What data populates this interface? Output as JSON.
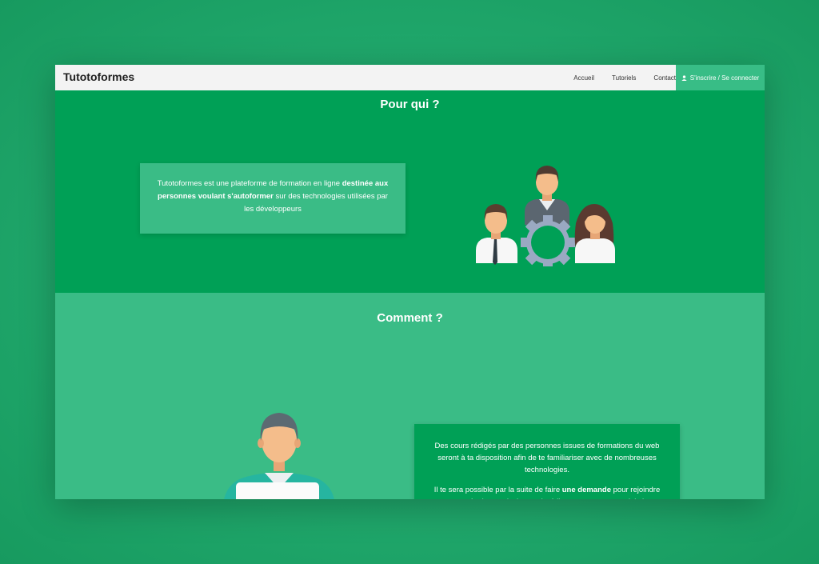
{
  "navbar": {
    "brand": "Tutotoformes",
    "links": [
      "Accueil",
      "Tutoriels",
      "Contact"
    ],
    "signin_label": "S'inscrire / Se connecter"
  },
  "section_pour_qui": {
    "title": "Pour qui ?",
    "text_1": "Tutotoformes est une plateforme de formation en ligne ",
    "text_bold": "destinée aux personnes voulant s'autoformer",
    "text_2": " sur des technologies utilisées par les développeurs"
  },
  "section_comment": {
    "title": "Comment ?",
    "para1": "Des cours rédigés par des personnes issues de formations du web seront à ta disposition afin de te familiariser avec de nombreuses technologies.",
    "para2_1": "Il te sera possible par la suite de faire ",
    "para2_bold": "une demande",
    "para2_2": " pour rejoindre notre équipe et ainsi pouvoir rédiger tes propres tutoriels !"
  },
  "colors": {
    "page_bg": "#22ab6f",
    "section_dark": "#00a056",
    "section_light": "#3abc86",
    "navbar_bg": "#f3f3f3"
  }
}
